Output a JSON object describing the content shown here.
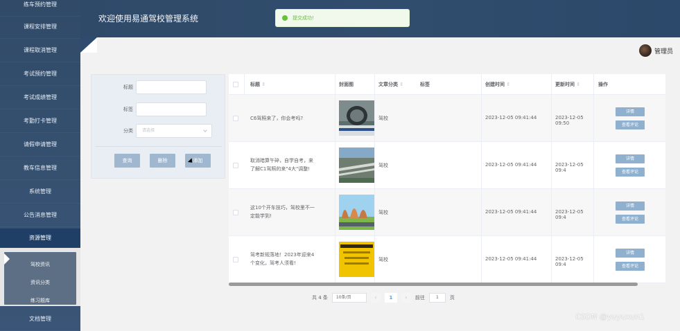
{
  "sidebar": {
    "items": [
      {
        "label": "练车预约管理"
      },
      {
        "label": "课程安排管理"
      },
      {
        "label": "课程取消管理"
      },
      {
        "label": "考试预约管理"
      },
      {
        "label": "考试成绩管理"
      },
      {
        "label": "考勤打卡管理"
      },
      {
        "label": "请假申请管理"
      },
      {
        "label": "教车信息管理"
      },
      {
        "label": "系统管理"
      },
      {
        "label": "公告消息管理"
      },
      {
        "label": "资源管理"
      },
      {
        "label": "文档管理"
      }
    ],
    "submenu": [
      {
        "label": "驾校资讯"
      },
      {
        "label": "资讯分类"
      },
      {
        "label": "练习题库"
      }
    ]
  },
  "header": {
    "title": "欢迎使用易通驾校管理系统",
    "toast": "提交成功!",
    "user": "管理员"
  },
  "search": {
    "title_label": "标题",
    "tags_label": "标签",
    "category_label": "分类",
    "category_placeholder": "请选择",
    "buttons": {
      "query": "查询",
      "delete": "删除",
      "add": "添加"
    }
  },
  "table": {
    "columns": {
      "title": "标题",
      "cover": "封面图",
      "category": "文章分类",
      "tags": "标签",
      "created": "创建时间",
      "updated": "更新时间",
      "actions": "操作"
    },
    "sort_icon": "⇕",
    "rows": [
      {
        "title": "C6驾照来了，你会考吗?",
        "category": "驾校",
        "created": "2023-12-05 09:41:44",
        "updated": "2023-12-05 09:50",
        "detail": "详情",
        "review": "查看评论"
      },
      {
        "title": "取消暗算午碎，自学自考，来了解C1驾照的来\"4大\"调整!",
        "category": "驾校",
        "created": "2023-12-05 09:41:44",
        "updated": "2023-12-05 09:4",
        "detail": "详情",
        "review": "查看评论"
      },
      {
        "title": "这10个开车技巧，驾校里不一定能学到!",
        "category": "驾校",
        "created": "2023-12-05 09:41:44",
        "updated": "2023-12-05 09:4",
        "detail": "详情",
        "review": "查看评论"
      },
      {
        "title": "驾考新规落地！2023年迎来4个变化，驾考人须看!",
        "category": "驾校",
        "created": "2023-12-05 09:41:44",
        "updated": "2023-12-05 09:4",
        "detail": "详情",
        "review": "查看评论"
      }
    ]
  },
  "pagination": {
    "total": "共 4 条",
    "page_size": "10条/页",
    "current": "1",
    "goto_label": "前往",
    "goto_value": "1",
    "page_suffix": "页",
    "prev": "‹",
    "next": "›"
  },
  "watermark": "CSDN @yuyuxun1",
  "icons": {
    "success": "check-circle-icon",
    "caret": "chevron-down-icon",
    "fold": "corner-fold-icon"
  },
  "colors": {
    "sidebar": "#304a68",
    "active": "#1f3f66",
    "button": "#9fb8cf",
    "op_button": "#8fb0cf"
  }
}
